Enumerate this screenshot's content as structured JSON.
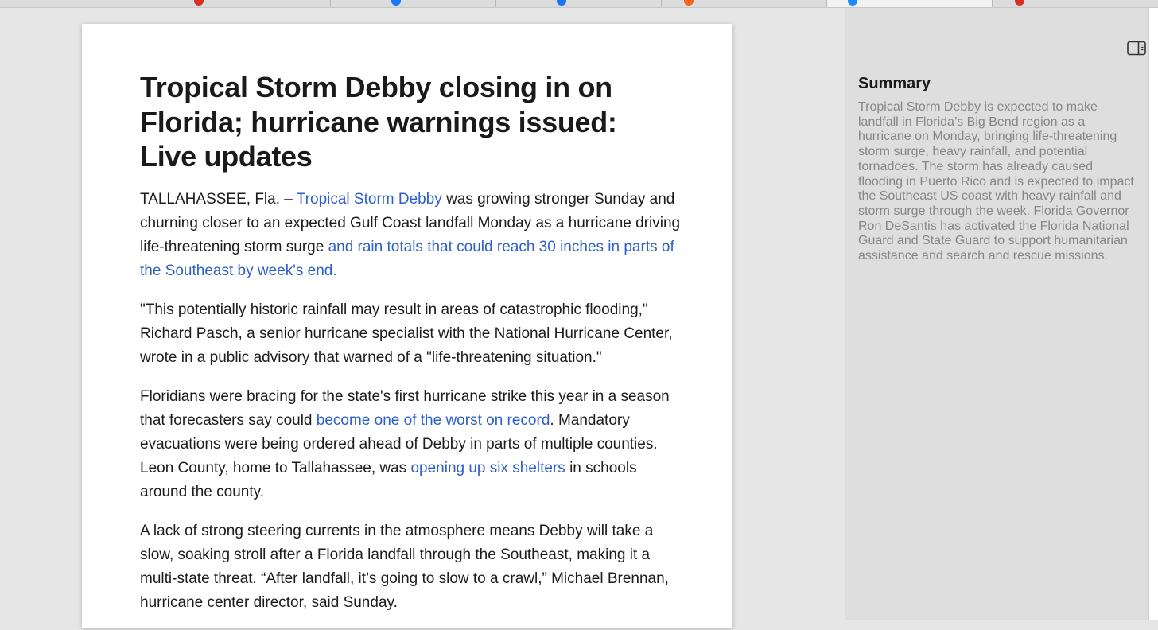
{
  "colors": {
    "link": "#2c5fcc",
    "page_background": "#e6e6e6",
    "sidebar_background": "#dedede",
    "summary_text": "#868686"
  },
  "tabs": [
    {
      "favicon_color": "#9a9a9a"
    },
    {
      "favicon_color": "#d93025"
    },
    {
      "favicon_color": "#1877f2"
    },
    {
      "favicon_color": "#1877f2"
    },
    {
      "favicon_color": "#f26522"
    },
    {
      "favicon_color": "#1a8cff",
      "active": true
    },
    {
      "favicon_color": "#d93025"
    }
  ],
  "article": {
    "title": "Tropical Storm Debby closing in on Florida; hurricane warnings issued: Live updates",
    "p1": {
      "t1": "TALLAHASSEE, Fla. – ",
      "link1": "Tropical Storm Debby",
      "t2": " was growing stronger Sunday and churning closer to an expected Gulf Coast landfall Monday as a hurricane driving life-threatening storm surge ",
      "link2": "and rain totals that could reach 30 inches in parts of the Southeast by week's end."
    },
    "p2": "\"This potentially historic rainfall may result in areas of catastrophic flooding,\" Richard Pasch, a senior hurricane specialist with the National Hurricane Center, wrote in a public advisory that warned of a \"life-threatening situation.\"",
    "p3": {
      "t1": "Floridians were bracing for the state's first hurricane strike this year in a season that forecasters say could ",
      "link1": "become one of the worst on record",
      "t2": ". Mandatory evacuations were being ordered ahead of Debby in parts of multiple counties. Leon County, home to Tallahassee, was ",
      "link2": "opening up six shelters",
      "t3": " in schools around the county."
    },
    "p4": "A lack of strong steering currents in the atmosphere means Debby will take a slow, soaking stroll after a Florida landfall through the Southeast, making it a multi-state threat. “After landfall, it’s going to slow to a crawl,”  Michael Brennan, hurricane center director, said Sunday."
  },
  "sidebar": {
    "toggle_icon": "sidebar-toggle-icon",
    "heading": "Summary",
    "text": "Tropical Storm Debby is expected to make landfall in Florida’s Big Bend region as a hurricane on Monday, bringing life-threatening storm surge, heavy rainfall, and potential tornadoes. The storm has already caused flooding in Puerto Rico and is expected to impact the Southeast US coast with heavy rainfall and storm surge through the week. Florida Governor Ron DeSantis has activated the Florida National Guard and State Guard to support humanitarian assistance and search and rescue missions."
  }
}
